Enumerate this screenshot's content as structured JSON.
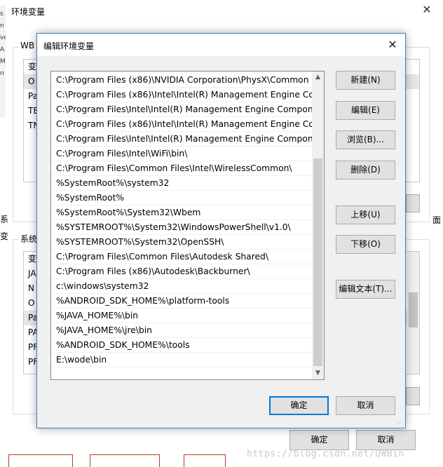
{
  "background_window": {
    "title": "环境变量",
    "close_glyph": "✕",
    "left_strip": [
      "s",
      "n",
      "ve",
      "A",
      "M",
      "n"
    ],
    "user_group_label": "WB",
    "user_list_header": "变",
    "user_list_rows": [
      "O",
      "Pa",
      "TE",
      "TN"
    ],
    "system_group_label": "系统",
    "system_list_header": "变",
    "system_list_rows": [
      "JA",
      "N",
      "O",
      "Pa",
      "PA",
      "PF",
      "PF"
    ],
    "edge_labels": [
      "系",
      "变",
      "面"
    ],
    "ok_label": "确定",
    "cancel_label": "取消",
    "watermark": "https://blog.csdn.net/QWBin"
  },
  "dialog": {
    "title": "编辑环境变量",
    "close_glyph": "✕",
    "paths": [
      "C:\\Program Files (x86)\\NVIDIA Corporation\\PhysX\\Common",
      "C:\\Program Files (x86)\\Intel\\Intel(R) Management Engine Co...",
      "C:\\Program Files\\Intel\\Intel(R) Management Engine Compon...",
      "C:\\Program Files (x86)\\Intel\\Intel(R) Management Engine Co...",
      "C:\\Program Files\\Intel\\Intel(R) Management Engine Compon...",
      "C:\\Program Files\\Intel\\WiFi\\bin\\",
      "C:\\Program Files\\Common Files\\Intel\\WirelessCommon\\",
      "%SystemRoot%\\system32",
      "%SystemRoot%",
      "%SystemRoot%\\System32\\Wbem",
      "%SYSTEMROOT%\\System32\\WindowsPowerShell\\v1.0\\",
      "%SYSTEMROOT%\\System32\\OpenSSH\\",
      "C:\\Program Files\\Common Files\\Autodesk Shared\\",
      "C:\\Program Files (x86)\\Autodesk\\Backburner\\",
      "c:\\windows\\system32",
      "%ANDROID_SDK_HOME%\\platform-tools",
      "%JAVA_HOME%\\bin",
      "%JAVA_HOME%\\jre\\bin",
      "%ANDROID_SDK_HOME%\\tools",
      "E:\\wode\\bin"
    ],
    "buttons": {
      "new": "新建(N)",
      "edit": "编辑(E)",
      "browse": "浏览(B)...",
      "delete": "删除(D)",
      "move_up": "上移(U)",
      "move_down": "下移(O)",
      "edit_text": "编辑文本(T)...",
      "ok": "确定",
      "cancel": "取消"
    },
    "scroll_up_glyph": "▲",
    "scroll_down_glyph": "▼"
  },
  "colors": {
    "dialog_border": "#3c7fc1",
    "primary_button_border": "#0078d7",
    "button_face": "#e1e1e1",
    "dialog_face": "#f0f0f0"
  }
}
